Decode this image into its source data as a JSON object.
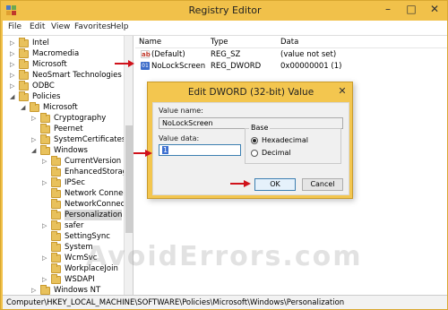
{
  "window": {
    "title": "Registry Editor",
    "min_glyph": "–",
    "max_glyph": "□",
    "close_glyph": "✕"
  },
  "menu": [
    "File",
    "Edit",
    "View",
    "Favorites",
    "Help"
  ],
  "tree": [
    {
      "label": "Intel",
      "expander": "▷"
    },
    {
      "label": "Macromedia",
      "expander": "▷"
    },
    {
      "label": "Microsoft",
      "expander": "▷"
    },
    {
      "label": "NeoSmart Technologies",
      "expander": "▷"
    },
    {
      "label": "ODBC",
      "expander": "▷"
    },
    {
      "label": "Policies",
      "expander": "◢"
    },
    {
      "label": "Microsoft",
      "expander": "◢"
    },
    {
      "label": "Cryptography",
      "expander": "▷"
    },
    {
      "label": "Peernet",
      "expander": ""
    },
    {
      "label": "SystemCertificates",
      "expander": "▷"
    },
    {
      "label": "Windows",
      "expander": "◢"
    },
    {
      "label": "CurrentVersion",
      "expander": "▷"
    },
    {
      "label": "EnhancedStorageD",
      "expander": ""
    },
    {
      "label": "IPSec",
      "expander": "▷"
    },
    {
      "label": "Network Connecti",
      "expander": ""
    },
    {
      "label": "NetworkConnectiv",
      "expander": ""
    },
    {
      "label": "Personalization",
      "expander": ""
    },
    {
      "label": "safer",
      "expander": "▷"
    },
    {
      "label": "SettingSync",
      "expander": ""
    },
    {
      "label": "System",
      "expander": ""
    },
    {
      "label": "WcmSvc",
      "expander": "▷"
    },
    {
      "label": "WorkplaceJoin",
      "expander": ""
    },
    {
      "label": "WSDAPI",
      "expander": "▷"
    },
    {
      "label": "Windows NT",
      "expander": "▷"
    }
  ],
  "columns": [
    "Name",
    "Type",
    "Data"
  ],
  "values": [
    {
      "icon": "ab",
      "name": "(Default)",
      "type": "REG_SZ",
      "data": "(value not set)"
    },
    {
      "icon": "01",
      "name": "NoLockScreen",
      "type": "REG_DWORD",
      "data": "0x00000001 (1)"
    }
  ],
  "status_path": "Computer\\HKEY_LOCAL_MACHINE\\SOFTWARE\\Policies\\Microsoft\\Windows\\Personalization",
  "dialog": {
    "title": "Edit DWORD (32-bit) Value",
    "close_glyph": "✕",
    "value_name_label": "Value name:",
    "value_name": "NoLockScreen",
    "value_data_label": "Value data:",
    "value_data": "1",
    "base_label": "Base",
    "hex_label": "Hexadecimal",
    "dec_label": "Decimal",
    "ok_label": "OK",
    "cancel_label": "Cancel"
  },
  "watermark": "AvoidErrors.com",
  "colors": {
    "arrow": "#d0121b",
    "frame": "#f1c14a"
  }
}
